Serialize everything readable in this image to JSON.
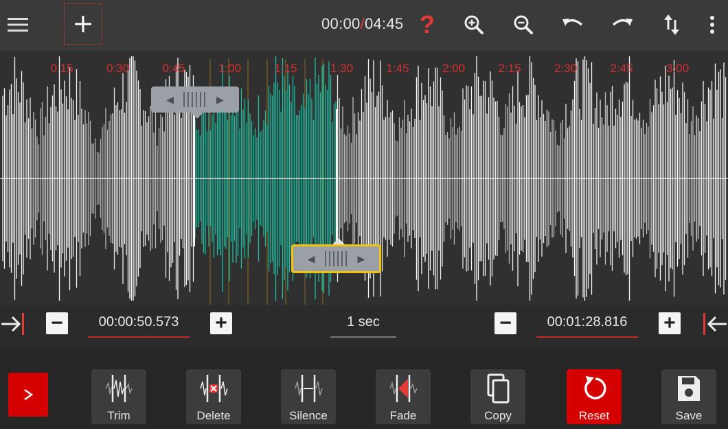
{
  "topbar": {
    "current_time": "00:00",
    "separator": "/",
    "total_time": "04:45",
    "help_label": "?",
    "icons": [
      "menu-icon",
      "add-icon",
      "help-icon",
      "zoom-in-icon",
      "zoom-out-icon",
      "undo-icon",
      "redo-icon",
      "swap-vertical-icon",
      "more-vert-icon"
    ]
  },
  "timeline": {
    "ticks": [
      "0:15",
      "0:30",
      "0:45",
      "1:00",
      "1:15",
      "1:30",
      "1:45",
      "2:00",
      "2:15",
      "2:30",
      "2:45",
      "3:00"
    ]
  },
  "selection": {
    "start_time": "00:00:50.573",
    "end_time": "00:01:28.816",
    "step": "1 sec",
    "minus": "−",
    "plus": "+"
  },
  "colors": {
    "accent_red": "#d50000",
    "selection": "#1fc3a4",
    "handle_focus": "#f1c40f"
  },
  "toolbar": {
    "tools": [
      {
        "label": "Trim",
        "icon": "trim-icon"
      },
      {
        "label": "Delete",
        "icon": "delete-icon"
      },
      {
        "label": "Silence",
        "icon": "silence-icon"
      },
      {
        "label": "Fade",
        "icon": "fade-icon"
      },
      {
        "label": "Copy",
        "icon": "copy-icon"
      },
      {
        "label": "Reset",
        "icon": "reset-icon"
      },
      {
        "label": "Save",
        "icon": "save-icon"
      }
    ]
  }
}
